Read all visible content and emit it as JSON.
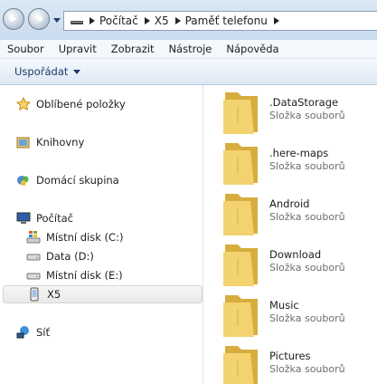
{
  "address_bar": {
    "breadcrumbs": [
      "Počítač",
      "X5",
      "Paměť telefonu"
    ]
  },
  "menu": {
    "items": [
      "Soubor",
      "Upravit",
      "Zobrazit",
      "Nástroje",
      "Nápověda"
    ]
  },
  "command_bar": {
    "organize_label": "Uspořádat"
  },
  "nav_pane": {
    "favorites": "Oblíbené položky",
    "libraries": "Knihovny",
    "homegroup": "Domácí skupina",
    "computer": "Počítač",
    "drives": [
      {
        "label": "Místní disk (C:)",
        "icon": "windows-drive-icon"
      },
      {
        "label": "Data (D:)",
        "icon": "drive-icon"
      },
      {
        "label": "Místní disk (E:)",
        "icon": "drive-icon"
      },
      {
        "label": "X5",
        "icon": "phone-icon",
        "selected": true
      }
    ],
    "network": "Síť"
  },
  "content": {
    "items": [
      {
        "name": ".DataStorage",
        "type": "Složka souborů"
      },
      {
        "name": ".here-maps",
        "type": "Složka souborů"
      },
      {
        "name": "Android",
        "type": "Složka souborů"
      },
      {
        "name": "Download",
        "type": "Složka souborů"
      },
      {
        "name": "Music",
        "type": "Složka souborů"
      },
      {
        "name": "Pictures",
        "type": "Složka souborů"
      }
    ]
  },
  "colors": {
    "folder_yellow": "#f3d36f",
    "folder_dark": "#d7ad3d",
    "address_bar_bg": "#d3e2f2",
    "organize_text": "#1c3b66"
  }
}
